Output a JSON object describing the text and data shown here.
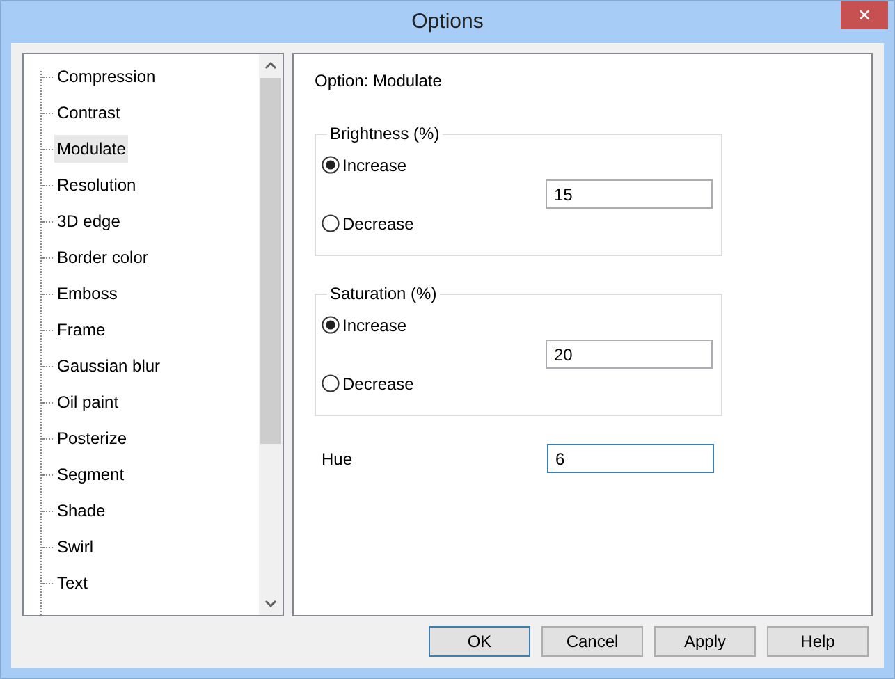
{
  "window": {
    "title": "Options",
    "close": "✕"
  },
  "tree": {
    "items": [
      {
        "label": "Compression",
        "selected": false
      },
      {
        "label": "Contrast",
        "selected": false
      },
      {
        "label": "Modulate",
        "selected": true
      },
      {
        "label": "Resolution",
        "selected": false
      },
      {
        "label": "3D edge",
        "selected": false
      },
      {
        "label": "Border color",
        "selected": false
      },
      {
        "label": "Emboss",
        "selected": false
      },
      {
        "label": "Frame",
        "selected": false
      },
      {
        "label": "Gaussian blur",
        "selected": false
      },
      {
        "label": "Oil paint",
        "selected": false
      },
      {
        "label": "Posterize",
        "selected": false
      },
      {
        "label": "Segment",
        "selected": false
      },
      {
        "label": "Shade",
        "selected": false
      },
      {
        "label": "Swirl",
        "selected": false
      },
      {
        "label": "Text",
        "selected": false
      }
    ]
  },
  "option_label": "Option: Modulate",
  "groups": [
    {
      "title": "Brightness (%)",
      "options": [
        {
          "label": "Increase",
          "selected": true
        },
        {
          "label": "Decrease",
          "selected": false
        }
      ],
      "value": "15"
    },
    {
      "title": "Saturation (%)",
      "options": [
        {
          "label": "Increase",
          "selected": true
        },
        {
          "label": "Decrease",
          "selected": false
        }
      ],
      "value": "20"
    }
  ],
  "hue": {
    "label": "Hue",
    "value": "6",
    "focused": true
  },
  "buttons": [
    {
      "label": "OK",
      "default": true
    },
    {
      "label": "Cancel",
      "default": false
    },
    {
      "label": "Apply",
      "default": false
    },
    {
      "label": "Help",
      "default": false
    }
  ]
}
